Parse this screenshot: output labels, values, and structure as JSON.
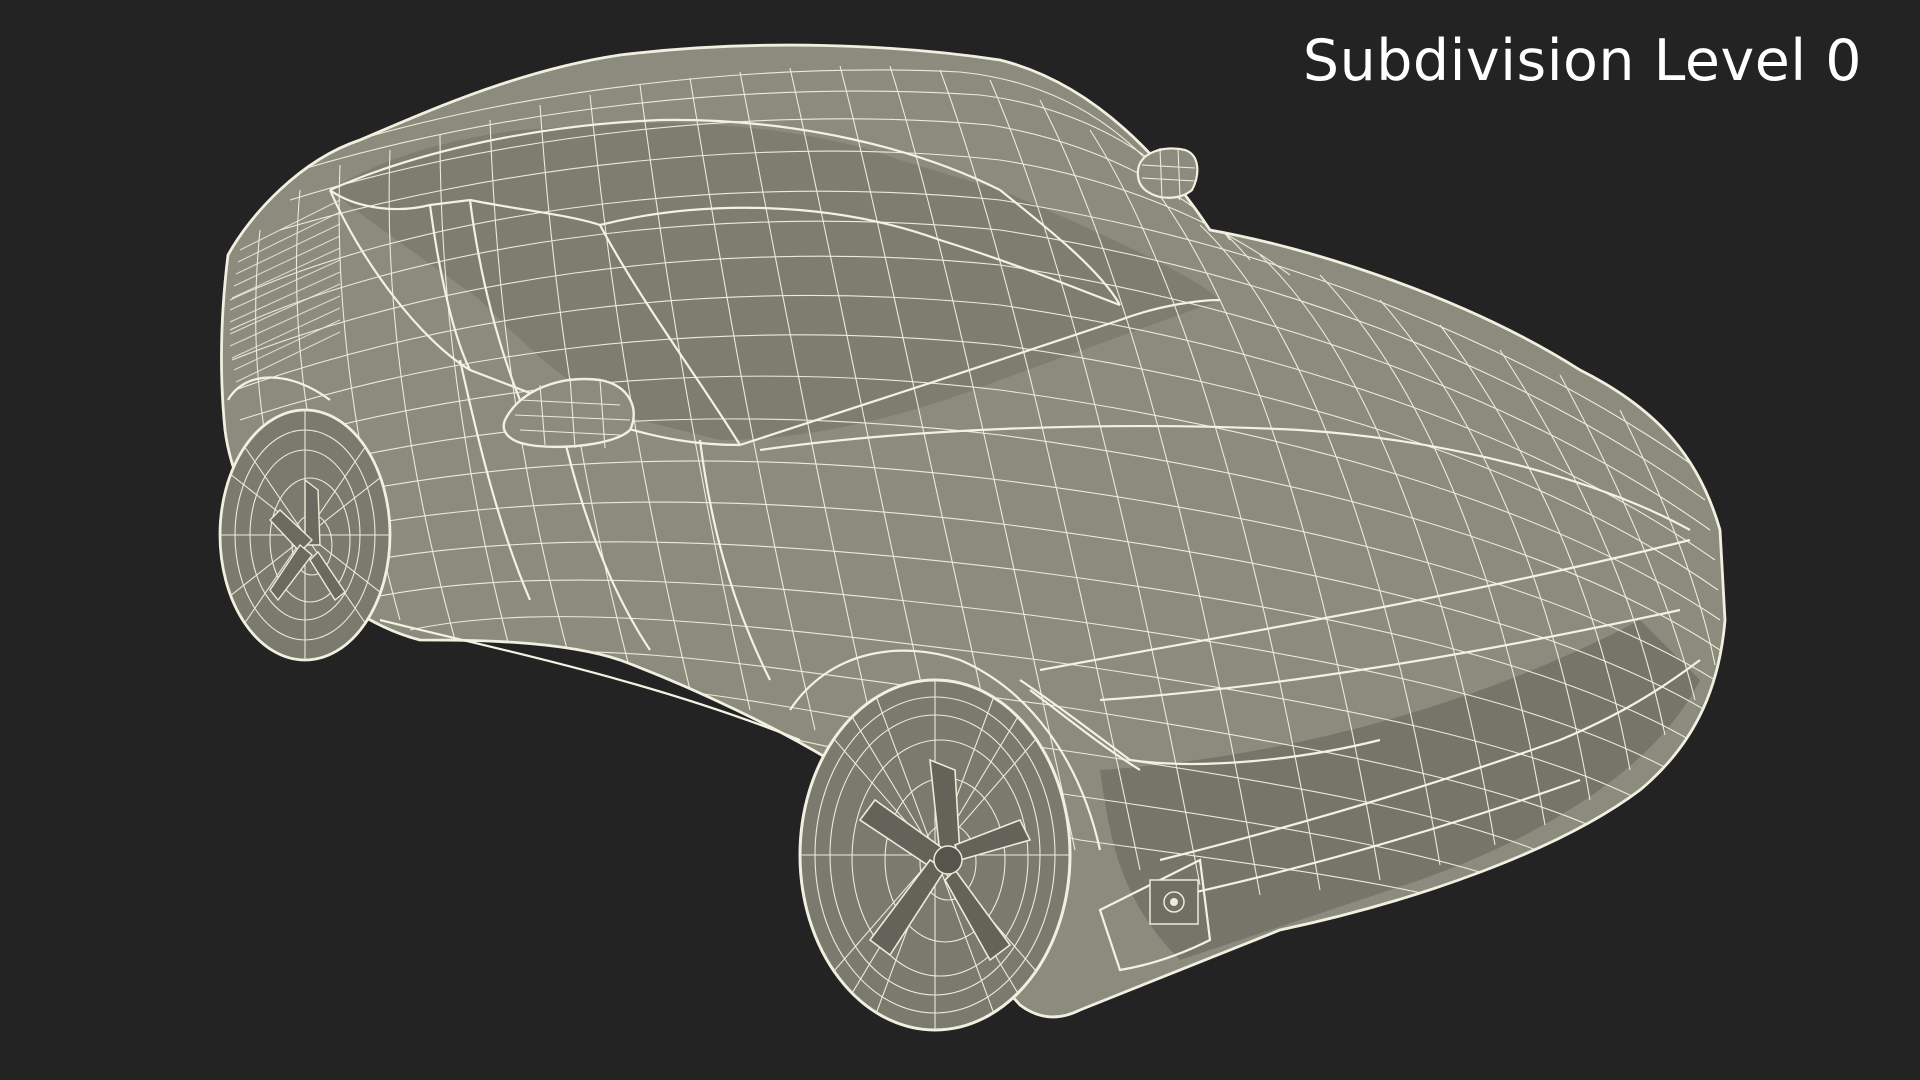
{
  "caption": "Subdivision Level 0",
  "colors": {
    "background": "#232323",
    "mesh_surface": "#8b8b7e",
    "wireframe": "#ecebd9",
    "caption_text": "#ffffff"
  },
  "render": {
    "subject": "car-wireframe-model",
    "style": "wireframe-over-shaded"
  }
}
